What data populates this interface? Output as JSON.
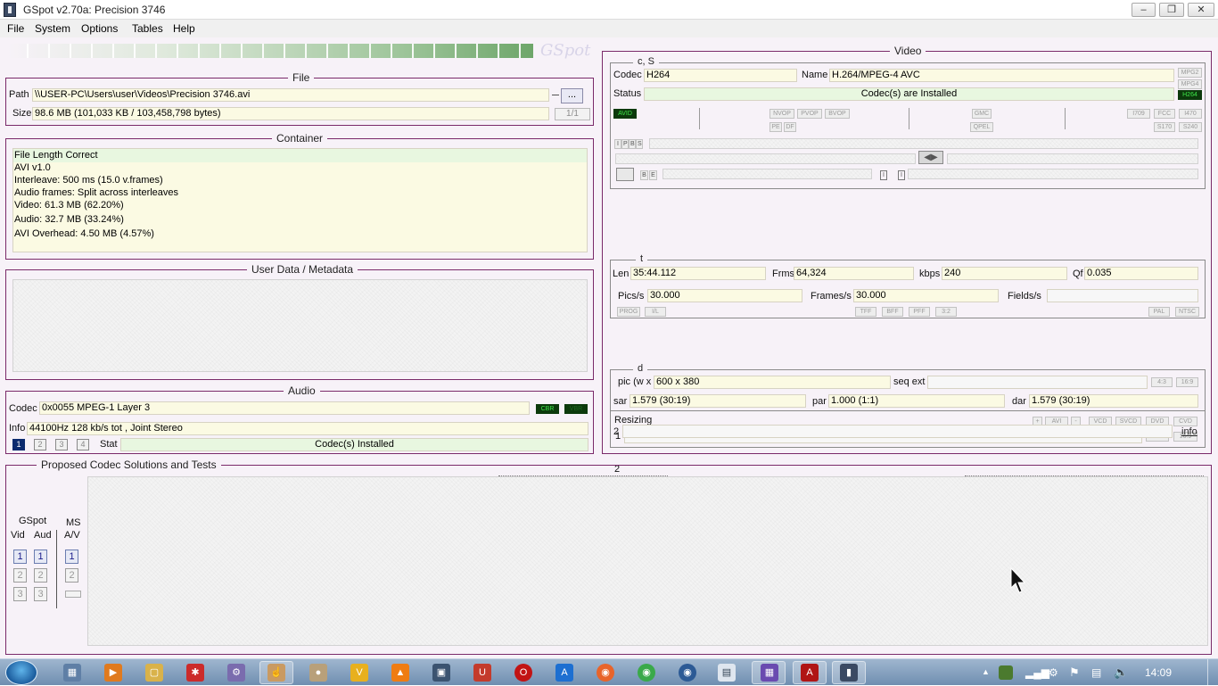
{
  "window": {
    "title": "GSpot v2.70a: Precision 3746"
  },
  "menu": [
    "File",
    "System",
    "Options",
    "Tables",
    "Help"
  ],
  "watermark": "GSpot",
  "file": {
    "title": "File",
    "path_label": "Path",
    "path_value": "\\\\USER-PC\\Users\\user\\Videos\\Precision 3746.avi",
    "browse_label": "...",
    "size_label": "Size",
    "size_value": "98.6 MB (101,033 KB / 103,458,798 bytes)",
    "page_value": "1/1"
  },
  "container": {
    "title": "Container",
    "lines": [
      "File Length Correct",
      "AVI v1.0",
      "Interleave: 500 ms (15.0 v.frames)",
      "Audio frames: Split across interleaves",
      "Video: 61.3 MB (62.20%)",
      "Audio: 32.7 MB (33.24%)",
      "AVI Overhead: 4.50 MB (4.57%)"
    ]
  },
  "userdata": {
    "title": "User Data / Metadata"
  },
  "audio": {
    "title": "Audio",
    "codec_label": "Codec",
    "codec_value": "0x0055 MPEG-1 Layer 3",
    "cbr_tag": "CBR",
    "vbr_tag": "VBR",
    "info_label": "Info",
    "info_value": "44100Hz  128 kb/s tot , Joint Stereo",
    "stream_buttons": [
      "1",
      "2",
      "3",
      "4"
    ],
    "stat_label": "Stat",
    "stat_value": "Codec(s) Installed"
  },
  "video": {
    "title": "Video",
    "cs_title": "c, S",
    "codec_label": "Codec",
    "codec_value": "H264",
    "name_label": "Name",
    "name_value": "H.264/MPEG-4 AVC",
    "status_label": "Status",
    "status_value": "Codec(s) are Installed",
    "side_tags": [
      "MPG2",
      "MPG4",
      "H264"
    ],
    "avid_tag": "AVID",
    "vop_tags": [
      "NVOP",
      "PVOP",
      "BVOP"
    ],
    "pe_tags": [
      "PE",
      "DF"
    ],
    "gmc_tags": [
      "GMC",
      "QPEL"
    ],
    "std_tags": [
      "I709",
      "FCC",
      "I470",
      "S170",
      "S240"
    ],
    "ipbs_tags": [
      "I",
      "P",
      "B",
      "S"
    ],
    "be_tags": [
      "B",
      "E"
    ],
    "t_title": "t",
    "len_label": "Len",
    "len_value": "35:44.112",
    "frms_label": "Frms",
    "frms_value": "64,324",
    "kbps_label": "kbps",
    "kbps_value": "240",
    "qf_label": "Qf",
    "qf_value": "0.035",
    "pics_label": "Pics/s",
    "pics_value": "30.000",
    "frames_label": "Frames/s",
    "frames_value": "30.000",
    "fields_label": "Fields/s",
    "scan_tags": [
      "PROG",
      "I/L"
    ],
    "field_tags": [
      "TFF",
      "BFF",
      "PFF",
      "3:2"
    ],
    "tv_tags": [
      "PAL",
      "NTSC"
    ],
    "d_title": "d",
    "pic_label": "pic (w x",
    "pic_value": "600 x 380",
    "seqext_label": "seq ext",
    "aspect_tags": [
      "4:3",
      "16:9"
    ],
    "sar_label": "sar",
    "sar_value": "1.579 (30:19)",
    "par_label": "par",
    "par_value": "1.000 (1:1)",
    "dar_label": "dar",
    "dar_value": "1.579 (30:19)",
    "resizing_label": "Resizing",
    "resize_tags": [
      "+",
      "AVI",
      "-",
      "VCD",
      "SVCD",
      "DVD",
      "CVD"
    ],
    "row1_label": "1",
    "row2_label": "2",
    "info_link": "info"
  },
  "proposed": {
    "title": "Proposed Codec Solutions and Tests",
    "gspot_label": "GSpot",
    "vid_label": "Vid",
    "aud_label": "Aud",
    "ms_label": "MS",
    "av_label": "A/V",
    "vid_buttons": [
      "1",
      "2",
      "3"
    ],
    "aud_buttons": [
      "1",
      "2",
      "3"
    ],
    "ms_buttons": [
      "1",
      "2"
    ]
  },
  "taskbar": {
    "clock": "14:09"
  }
}
